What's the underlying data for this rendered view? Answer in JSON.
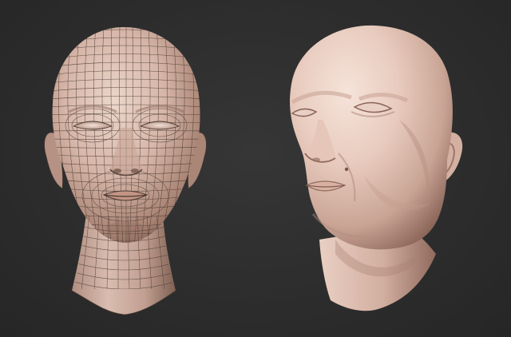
{
  "scene": {
    "background": "#2c2c2c",
    "left_model": {
      "kind": "wireframe-head",
      "skin_light": "#e2c9bd",
      "skin_mid": "#c8a697",
      "skin_shadow": "#7a5a4e",
      "wire_color": "#4a3a33"
    },
    "right_model": {
      "kind": "clay-head",
      "skin_light": "#f1dad0",
      "skin_mid": "#d8b5a6",
      "skin_shadow": "#8e6a5c"
    }
  }
}
